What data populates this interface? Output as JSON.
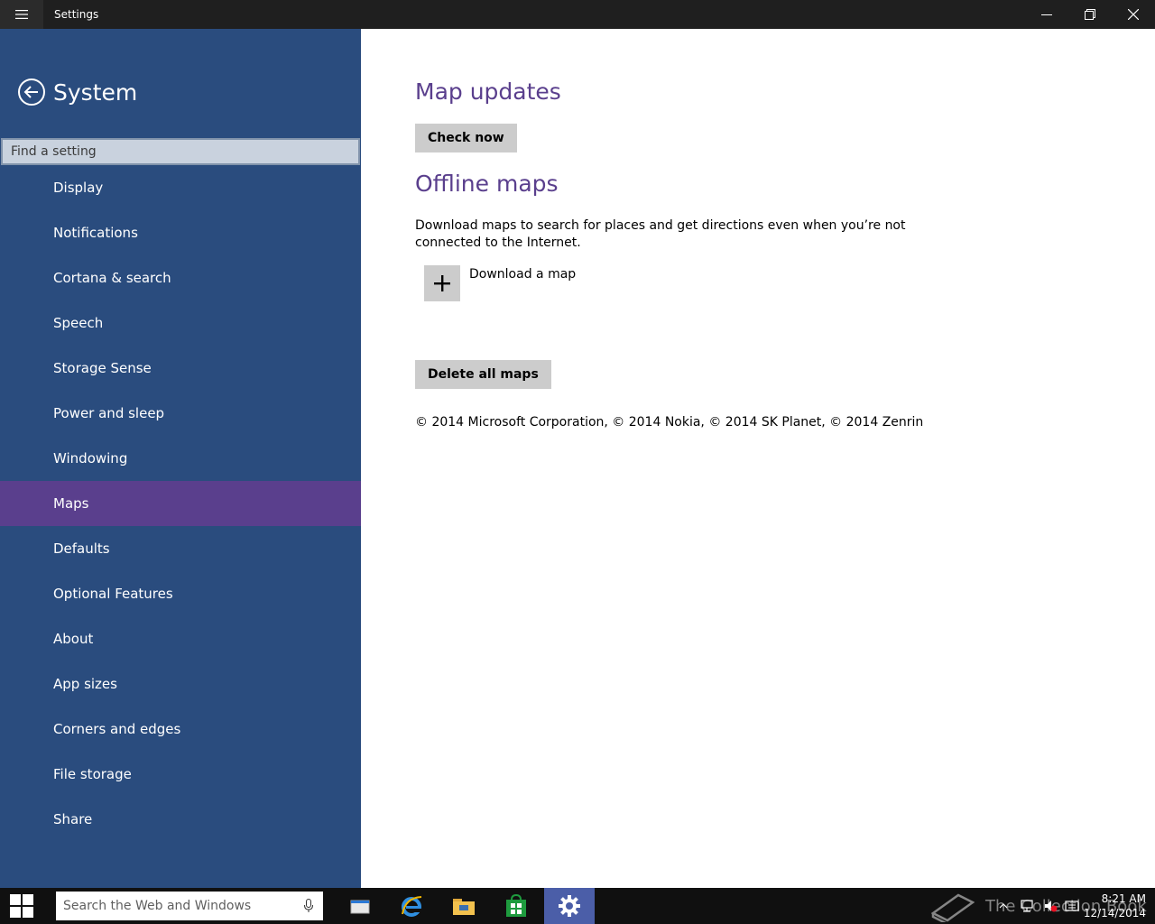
{
  "window": {
    "title": "Settings"
  },
  "sidebar": {
    "section_title": "System",
    "search_placeholder": "Find a setting",
    "items": [
      {
        "label": "Display"
      },
      {
        "label": "Notifications"
      },
      {
        "label": "Cortana & search"
      },
      {
        "label": "Speech"
      },
      {
        "label": "Storage Sense"
      },
      {
        "label": "Power and sleep"
      },
      {
        "label": "Windowing"
      },
      {
        "label": "Maps",
        "selected": true
      },
      {
        "label": "Defaults"
      },
      {
        "label": "Optional Features"
      },
      {
        "label": "About"
      },
      {
        "label": "App sizes"
      },
      {
        "label": "Corners and edges"
      },
      {
        "label": "File storage"
      },
      {
        "label": "Share"
      }
    ]
  },
  "main": {
    "map_updates_heading": "Map updates",
    "check_now_label": "Check now",
    "offline_maps_heading": "Offline maps",
    "offline_description": "Download maps to search for places and get directions even when you’re not connected to the Internet.",
    "download_map_label": "Download a map",
    "delete_all_label": "Delete all maps",
    "copyright": "© 2014 Microsoft Corporation, © 2014 Nokia, © 2014 SK Planet, © 2014 Zenrin"
  },
  "taskbar": {
    "search_placeholder": "Search the Web and Windows",
    "watermark": "The Collection Book",
    "time": "8:21 AM",
    "date": "12/14/2014"
  },
  "colors": {
    "sidebar_bg": "#2a4c7e",
    "accent_purple": "#5a3f8d",
    "taskbar_bg": "#101010",
    "button_gray": "#cccccc"
  }
}
